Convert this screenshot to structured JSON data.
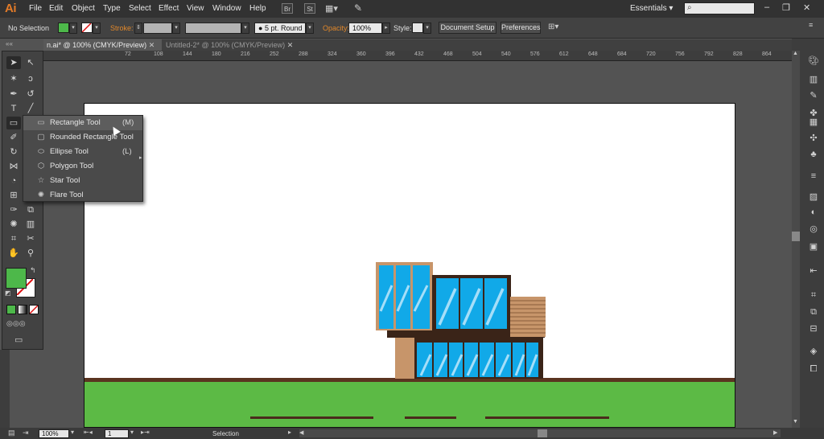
{
  "app": {
    "logo": "Ai"
  },
  "menu": [
    "File",
    "Edit",
    "Object",
    "Type",
    "Select",
    "Effect",
    "View",
    "Window",
    "Help"
  ],
  "menu_buttons": [
    "Br",
    "St"
  ],
  "workspace": {
    "label": "Essentials",
    "arrow": "▾"
  },
  "window_controls": [
    "–",
    "❐",
    "✕"
  ],
  "control_bar": {
    "selection_label": "No Selection",
    "fill_color": "#4db84a",
    "stroke_label": "Stroke:",
    "brush_label": "5 pt. Round",
    "opacity_label": "Opacity:",
    "opacity_value": "100%",
    "style_label": "Style:",
    "document_setup": "Document Setup",
    "preferences": "Preferences"
  },
  "tabs": [
    {
      "label": "n.ai* @ 100% (CMYK/Preview)",
      "close": "✕"
    },
    {
      "label": "Untitled-2* @ 100% (CMYK/Preview)",
      "close": "✕"
    }
  ],
  "ruler": [
    "72",
    "108",
    "144",
    "180",
    "216",
    "252",
    "288",
    "324",
    "360",
    "396",
    "432",
    "468",
    "504",
    "540",
    "576",
    "612",
    "648",
    "684",
    "720",
    "756",
    "792",
    "828",
    "864",
    "900",
    "936",
    "972",
    "1008",
    "1044",
    "1080",
    "1115"
  ],
  "flyout": [
    {
      "icon": "rectangle-icon",
      "glyph": "▭",
      "label": "Rectangle Tool",
      "key": "(M)"
    },
    {
      "icon": "rounded-rectangle-icon",
      "glyph": "▢",
      "label": "Rounded Rectangle Tool",
      "key": ""
    },
    {
      "icon": "ellipse-icon",
      "glyph": "⬭",
      "label": "Ellipse Tool",
      "key": "(L)"
    },
    {
      "icon": "polygon-icon",
      "glyph": "⬡",
      "label": "Polygon Tool",
      "key": ""
    },
    {
      "icon": "star-icon",
      "glyph": "☆",
      "label": "Star Tool",
      "key": ""
    },
    {
      "icon": "flare-icon",
      "glyph": "✺",
      "label": "Flare Tool",
      "key": ""
    }
  ],
  "status": {
    "zoom": "100%",
    "page": "1",
    "tool": "Selection"
  },
  "colors": {
    "grass": "#5cba45",
    "ground": "#5a3420",
    "glass": "#11a9e8",
    "wood": "#c7956a",
    "frame": "#3a2418",
    "fill": "#4db84a"
  }
}
